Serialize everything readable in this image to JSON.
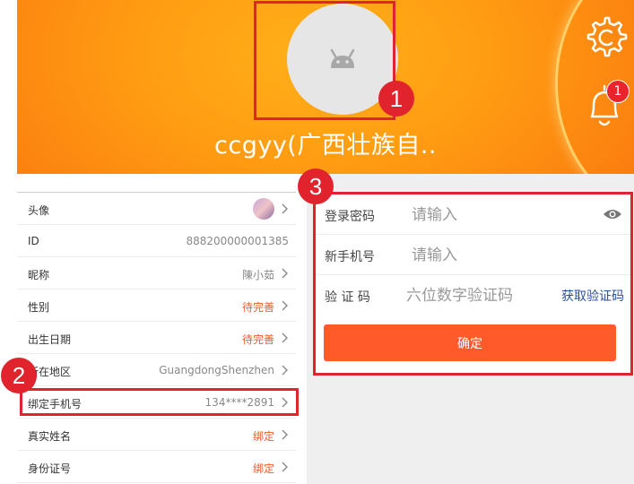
{
  "header": {
    "username": "ccgyy(广西壮族自..",
    "notification_count": "1"
  },
  "callouts": [
    "1",
    "2",
    "3"
  ],
  "profile_rows": [
    {
      "label": "头像",
      "value": "",
      "style": "avatar"
    },
    {
      "label": "ID",
      "value": "888200000001385",
      "style": "plain"
    },
    {
      "label": "昵称",
      "value": "陳小茹",
      "style": "plain"
    },
    {
      "label": "性别",
      "value": "待完善",
      "style": "warn"
    },
    {
      "label": "出生日期",
      "value": "待完善",
      "style": "warn"
    },
    {
      "label": "所在地区",
      "value": "GuangdongShenzhen",
      "style": "plain"
    },
    {
      "label": "绑定手机号",
      "value": "134****2891",
      "style": "plain"
    },
    {
      "label": "真实姓名",
      "value": "绑定",
      "style": "warn"
    },
    {
      "label": "身份证号",
      "value": "绑定",
      "style": "warn"
    }
  ],
  "form": {
    "password_label": "登录密码",
    "password_placeholder": "请输入",
    "phone_label": "新手机号",
    "phone_placeholder": "请输入",
    "code_label": "验 证 码",
    "code_placeholder": "六位数字验证码",
    "get_code_label": "获取验证码",
    "confirm_label": "确定"
  },
  "colors": {
    "accent": "#ff5a2a",
    "warning_text": "#f05a28",
    "callout_red": "#e0232c",
    "link_blue": "#2b4fa0"
  }
}
